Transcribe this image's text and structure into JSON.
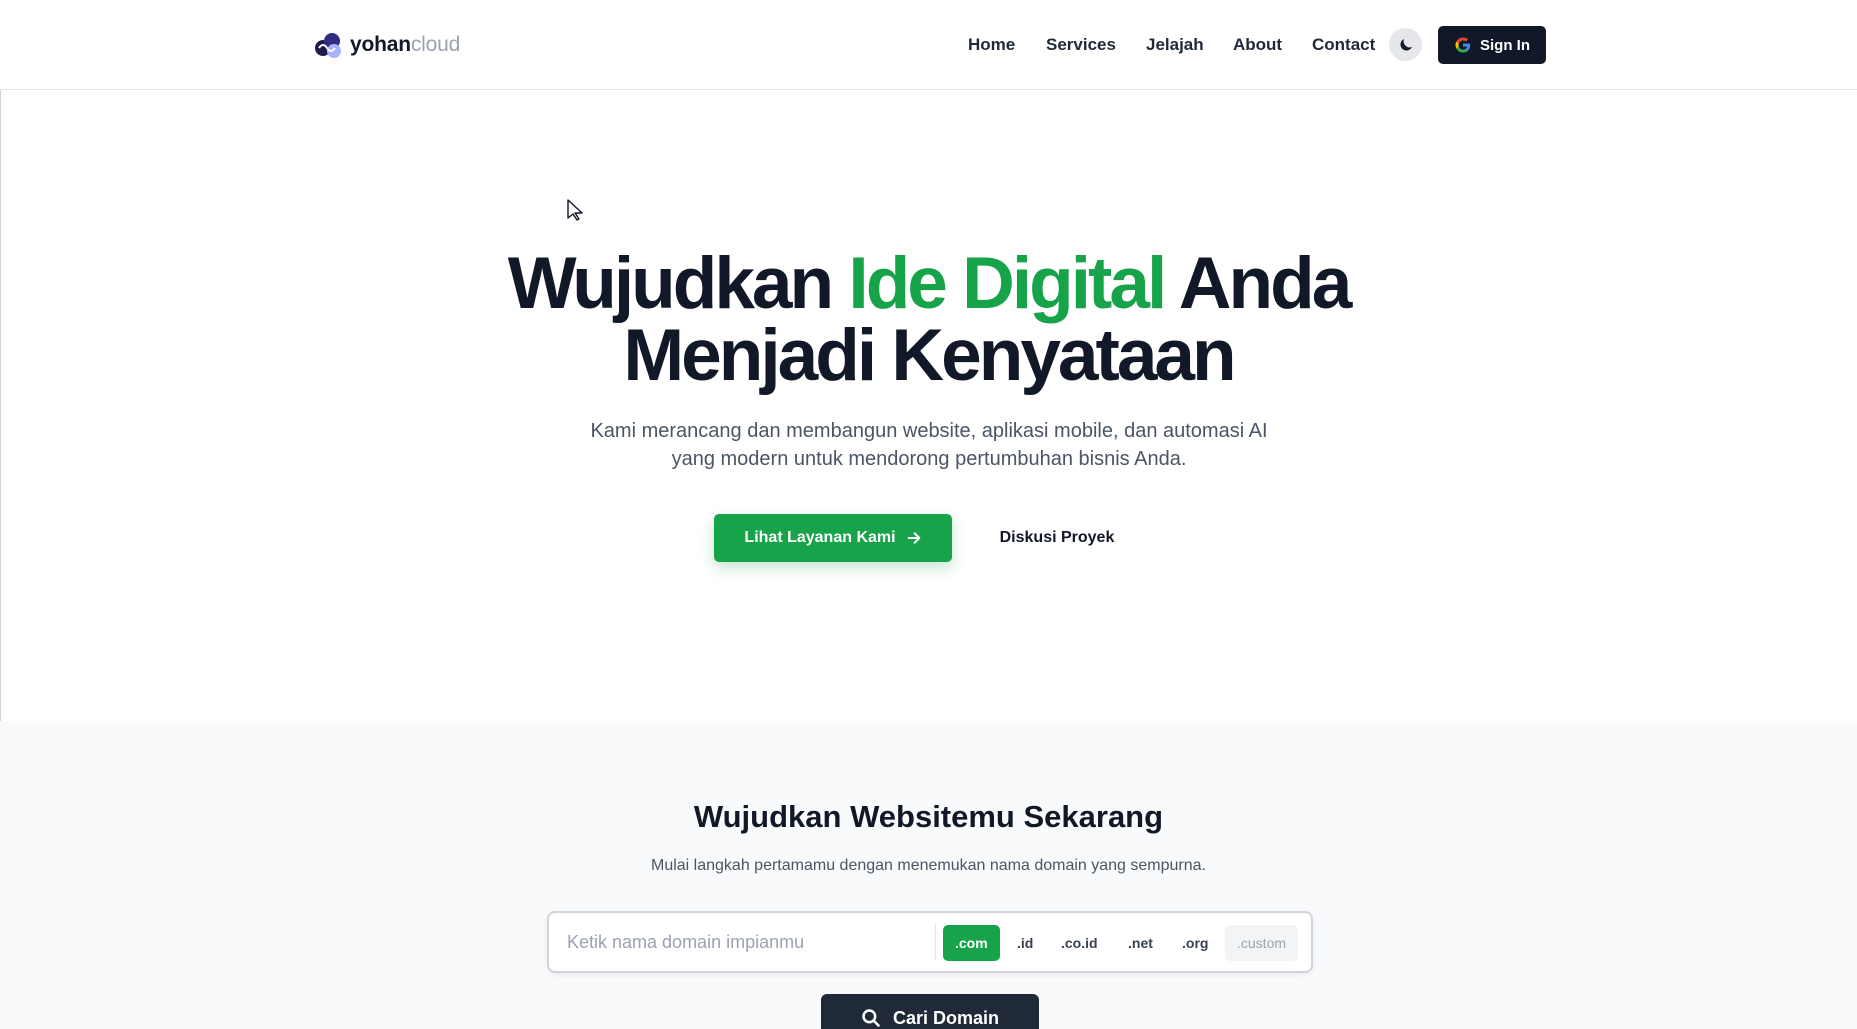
{
  "brand": {
    "name_bold": "yohan",
    "name_light": "cloud",
    "logo_icon": "cloud-infinity-logo"
  },
  "nav": {
    "items": [
      {
        "label": "Home"
      },
      {
        "label": "Services"
      },
      {
        "label": "Jelajah"
      },
      {
        "label": "About"
      },
      {
        "label": "Contact"
      }
    ],
    "theme_toggle_icon": "moon-icon",
    "signin_label": "Sign In",
    "signin_icon": "google-icon"
  },
  "hero": {
    "title_part1": "Wujudkan ",
    "title_accent": "Ide Digital",
    "title_part2": " Anda",
    "title_line2": "Menjadi Kenyataan",
    "subtitle": "Kami merancang dan membangun website, aplikasi mobile, dan automasi AI yang modern untuk mendorong pertumbuhan bisnis Anda.",
    "primary_button": "Lihat Layanan Kami",
    "secondary_button": "Diskusi Proyek"
  },
  "domain": {
    "title": "Wujudkan Websitemu Sekarang",
    "subtitle": "Mulai langkah pertamamu dengan menemukan nama domain yang sempurna.",
    "placeholder": "Ketik nama domain impianmu",
    "tlds": [
      ".com",
      ".id",
      ".co.id",
      ".net",
      ".org",
      ".custom"
    ],
    "selected_tld": ".com",
    "search_button": "Cari Domain"
  },
  "colors": {
    "accent": "#16a34a",
    "dark": "#111827",
    "text_muted": "#4b5563",
    "section_bg": "#f9fafb"
  }
}
